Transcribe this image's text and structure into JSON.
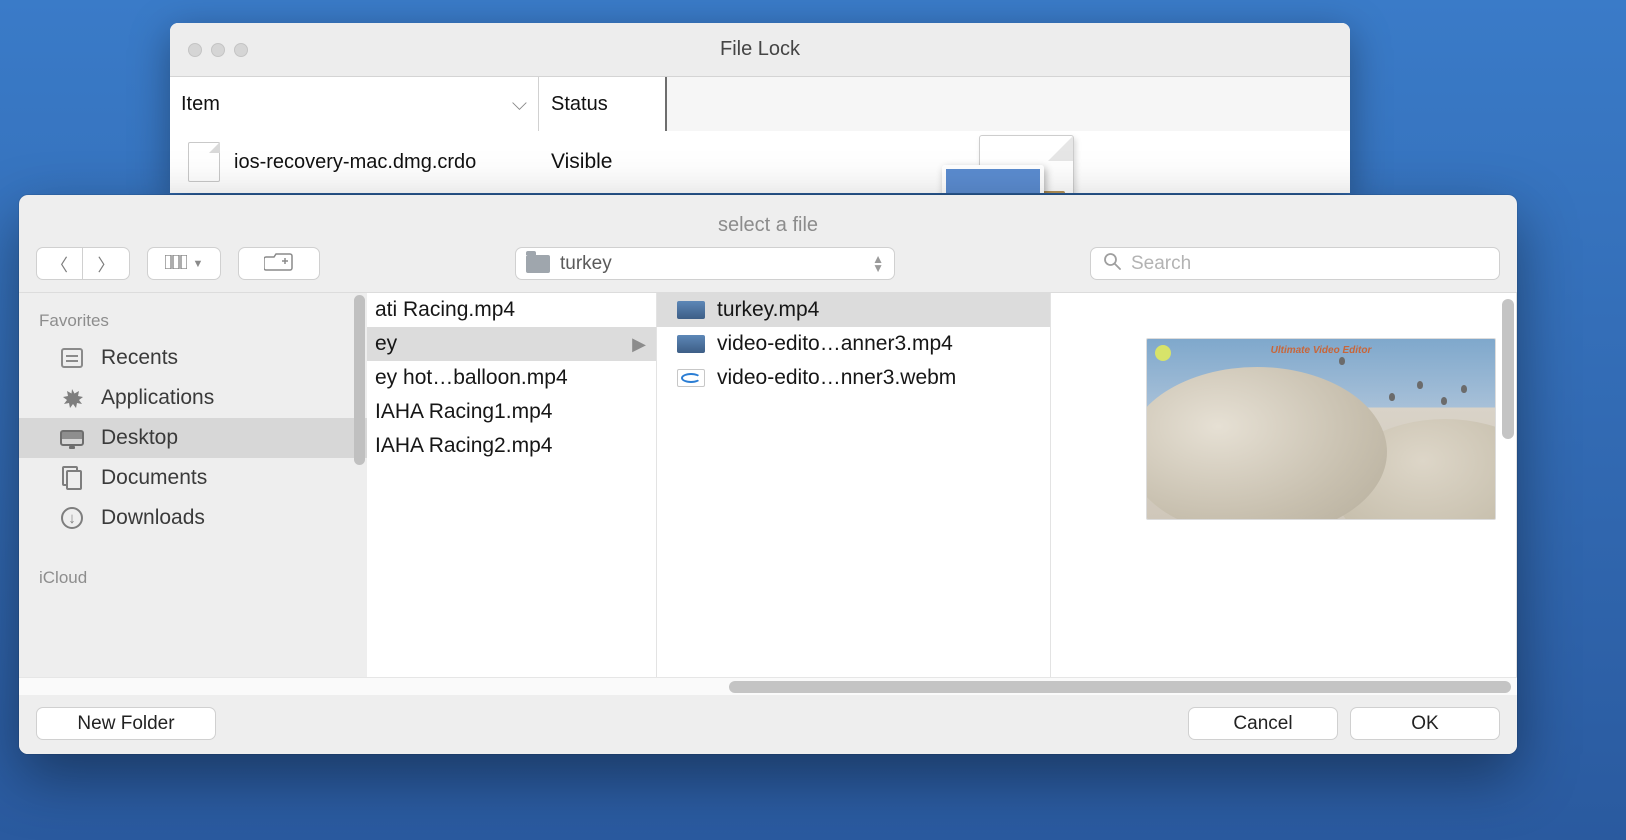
{
  "filelock": {
    "window_title": "File Lock",
    "columns": {
      "item": "Item",
      "status": "Status"
    },
    "row": {
      "name": "ios-recovery-mac.dmg.crdo",
      "status": "Visible"
    }
  },
  "sheet": {
    "title": "select a file",
    "path_name": "turkey",
    "search_placeholder": "Search",
    "new_folder_label": "New Folder",
    "cancel_label": "Cancel",
    "ok_label": "OK"
  },
  "sidebar": {
    "favorites_header": "Favorites",
    "icloud_header": "iCloud",
    "items": [
      {
        "icon": "recents",
        "label": "Recents",
        "selected": false
      },
      {
        "icon": "applications",
        "label": "Applications",
        "selected": false
      },
      {
        "icon": "desktop",
        "label": "Desktop",
        "selected": true
      },
      {
        "icon": "documents",
        "label": "Documents",
        "selected": false
      },
      {
        "icon": "downloads",
        "label": "Downloads",
        "selected": false
      }
    ]
  },
  "columns": {
    "col1": [
      {
        "label": "ati Racing.mp4",
        "type": "file",
        "selected": false
      },
      {
        "label": "ey",
        "type": "folder",
        "selected": true
      },
      {
        "label": "ey hot…balloon.mp4",
        "type": "file",
        "selected": false
      },
      {
        "label": "IAHA Racing1.mp4",
        "type": "file",
        "selected": false
      },
      {
        "label": "IAHA Racing2.mp4",
        "type": "file",
        "selected": false
      }
    ],
    "col2": [
      {
        "label": "turkey.mp4",
        "thumb": "video",
        "selected": true
      },
      {
        "label": "video-edito…anner3.mp4",
        "thumb": "video",
        "selected": false
      },
      {
        "label": "video-edito…nner3.webm",
        "thumb": "webm",
        "selected": false
      }
    ]
  },
  "preview": {
    "overlay_title": "Ultimate Video Editor"
  }
}
